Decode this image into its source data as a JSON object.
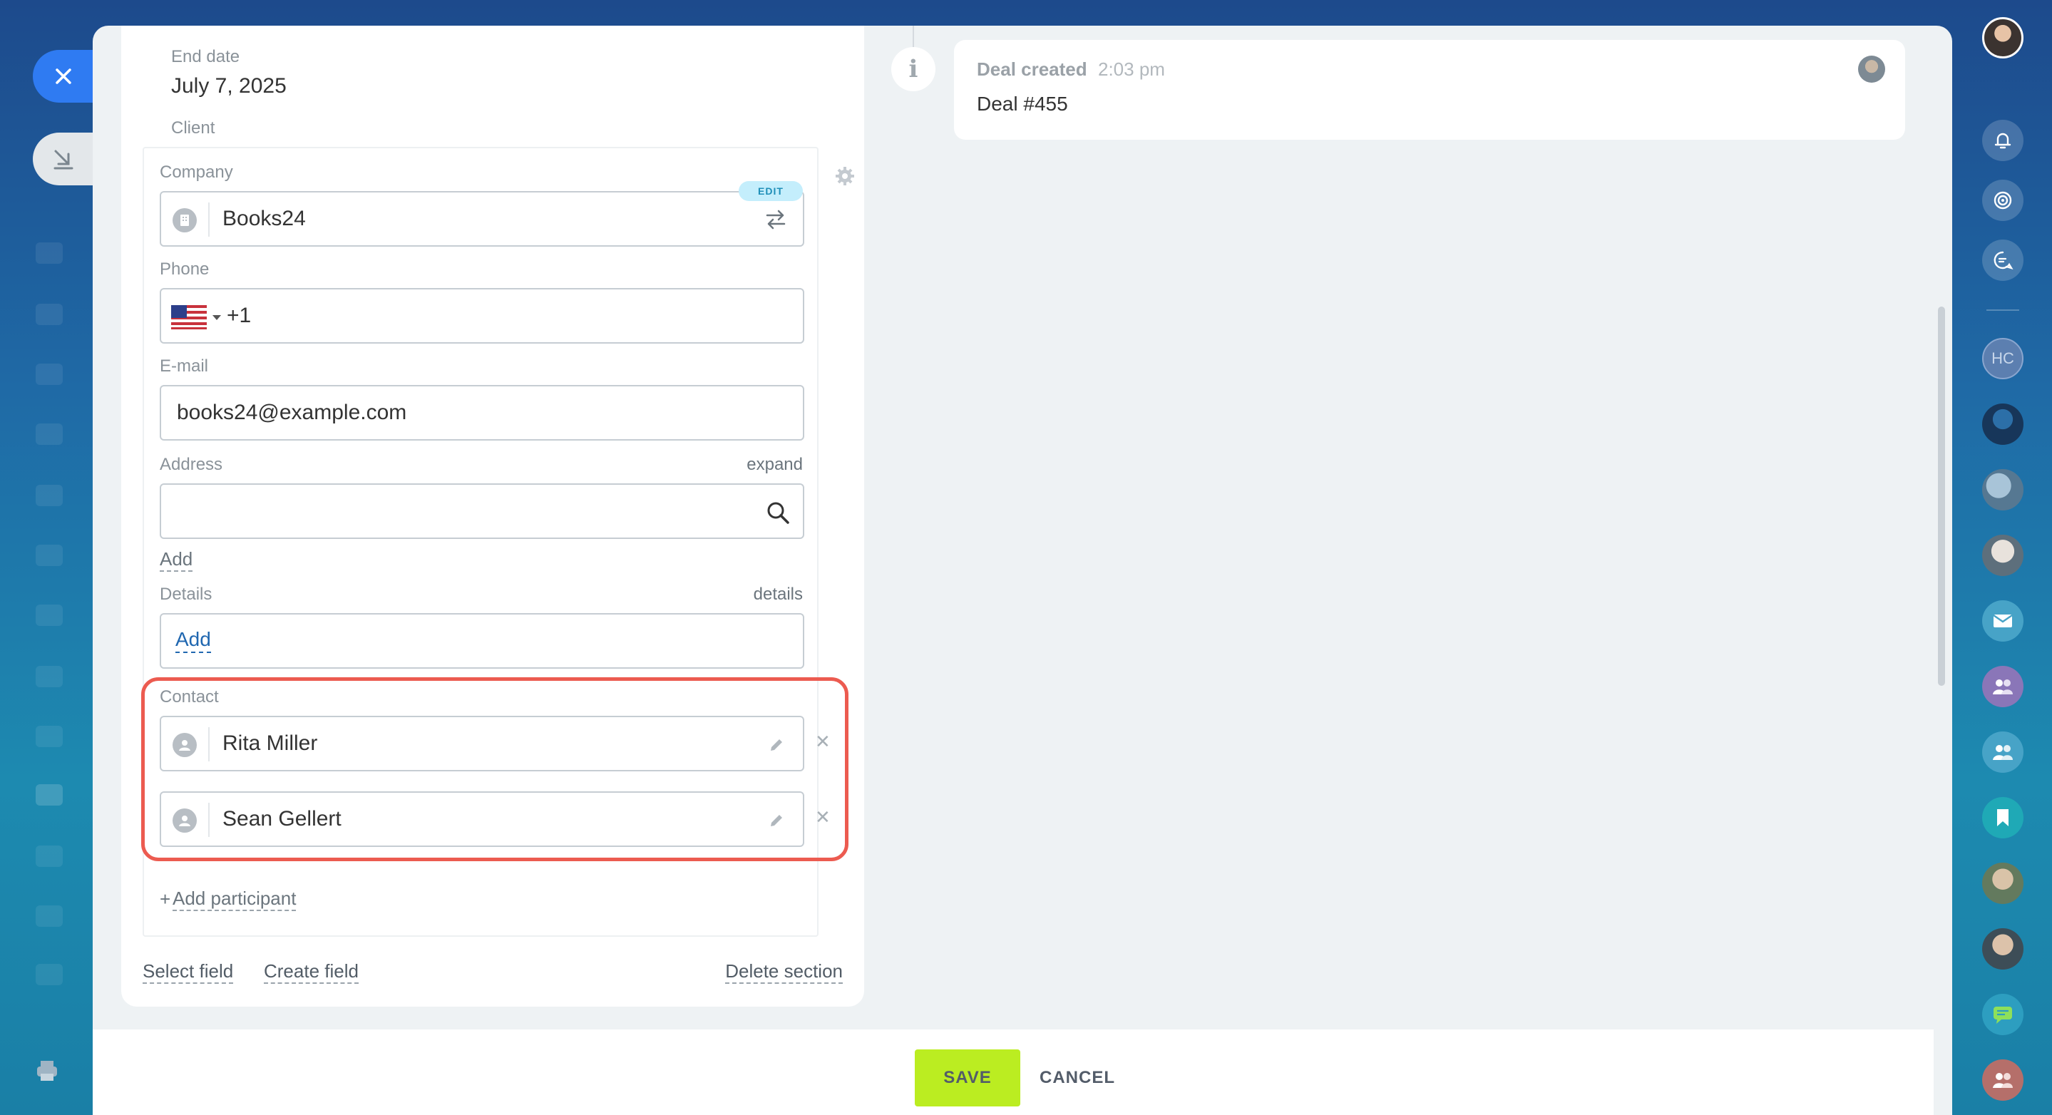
{
  "deal": {
    "end_date_label": "End date",
    "end_date_value": "July 7, 2025",
    "client_label": "Client"
  },
  "company": {
    "label": "Company",
    "value": "Books24",
    "edit_badge": "EDIT"
  },
  "phone": {
    "label": "Phone",
    "country_code": "+1"
  },
  "email": {
    "label": "E-mail",
    "value": "books24@example.com"
  },
  "address": {
    "label": "Address",
    "expand_link": "expand",
    "add_link": "Add"
  },
  "details": {
    "label": "Details",
    "details_link": "details",
    "add_link": "Add"
  },
  "contacts": {
    "label": "Contact",
    "items": [
      {
        "name": "Rita Miller"
      },
      {
        "name": "Sean Gellert"
      }
    ],
    "add_participant": "Add participant",
    "add_participant_prefix": "+"
  },
  "section_actions": {
    "select_field": "Select field",
    "create_field": "Create field",
    "delete_section": "Delete section"
  },
  "timeline": {
    "event_title": "Deal created",
    "event_time": "2:03 pm",
    "event_body": "Deal #455"
  },
  "footer": {
    "save": "SAVE",
    "cancel": "CANCEL"
  },
  "right_sidebar": {
    "initials_avatar": "HC"
  },
  "colors": {
    "accent_blue": "#2f7bf2",
    "save_green": "#bbed21",
    "highlight_red": "#ec5b50",
    "link_blue": "#2067b0"
  }
}
